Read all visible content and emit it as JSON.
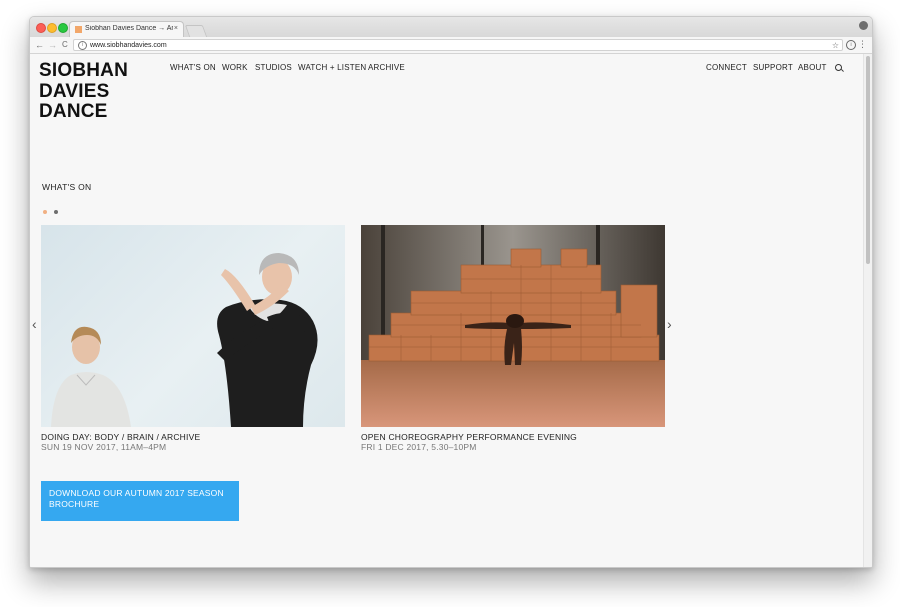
{
  "browser": {
    "tab_title": "Siobhan Davies Dance → An in",
    "tab_close": "×",
    "url": "www.siobhandavies.com",
    "back": "←",
    "forward": "→",
    "reload": "C",
    "star": "☆",
    "menu": "⋮"
  },
  "site": {
    "logo_lines": [
      "SIOBHAN",
      "DAVIES",
      "DANCE"
    ],
    "nav_left": [
      "WHAT'S ON",
      "WORK",
      "STUDIOS",
      "WATCH + LISTEN",
      "ARCHIVE"
    ],
    "nav_right": [
      "CONNECT",
      "SUPPORT",
      "ABOUT"
    ]
  },
  "section": {
    "title": "WHAT'S ON",
    "carousel_pages": 2,
    "active_page": 1,
    "prev_arrow": "‹",
    "next_arrow": "›"
  },
  "events": [
    {
      "title": "DOING DAY: BODY / BRAIN / ARCHIVE",
      "date": "SUN 19 NOV 2017, 11AM–4PM"
    },
    {
      "title": "OPEN CHOREOGRAPHY PERFORMANCE EVENING",
      "date": "FRI 1 DEC 2017, 5.30–10PM"
    }
  ],
  "cta": {
    "label": "DOWNLOAD OUR AUTUMN 2017 SEASON BROCHURE"
  },
  "colors": {
    "cta": "#35a8f0",
    "active_dot": "#f1b083",
    "page_bg": "#f7f7f7"
  }
}
